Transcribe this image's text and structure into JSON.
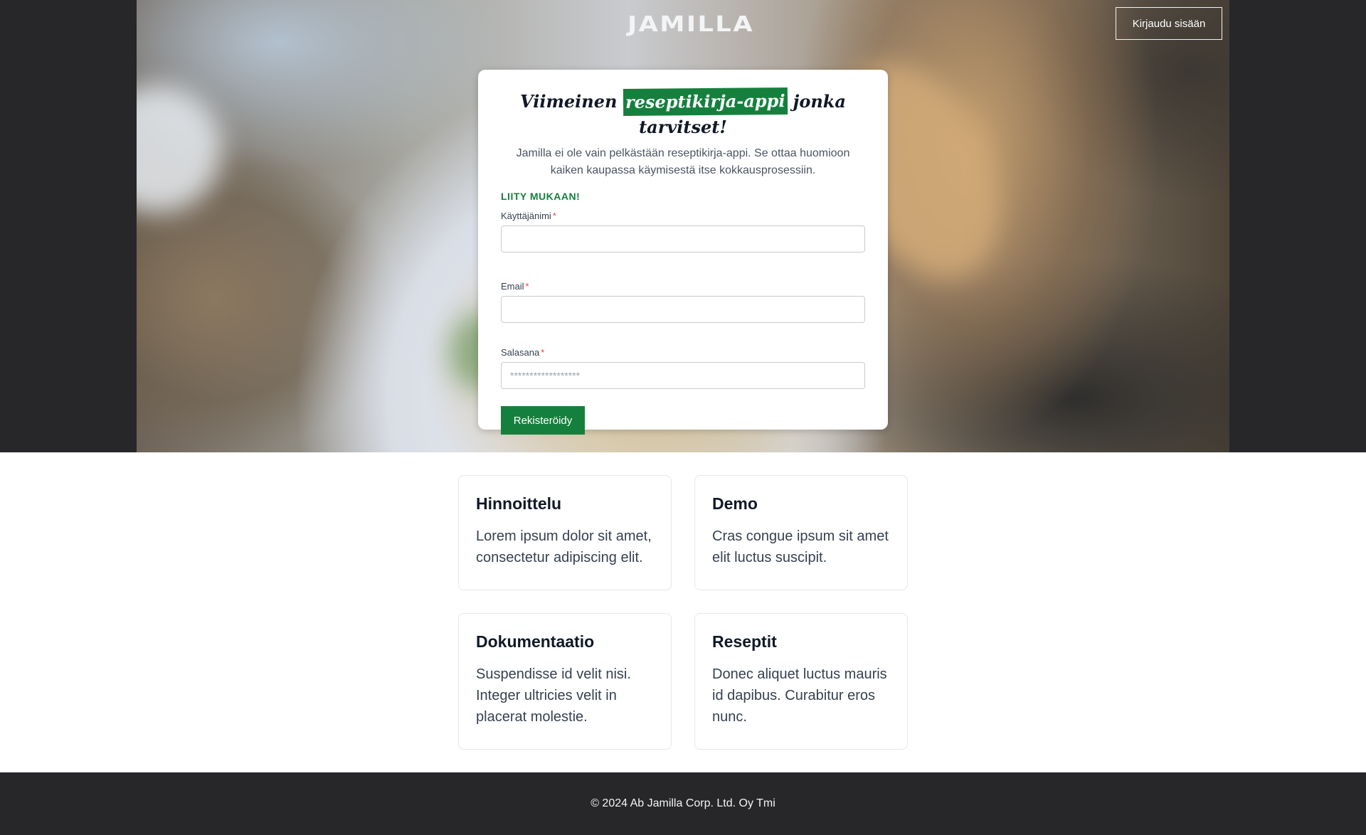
{
  "header": {
    "logo_text": "JAMILLA",
    "login_label": "Kirjaudu sisään"
  },
  "signup": {
    "headline_start": "Viimeinen",
    "headline_highlight": "reseptikirja-appi",
    "headline_end": "jonka tarvitset!",
    "subtitle": "Jamilla ei ole vain pelkästään reseptikirja-appi. Se ottaa huomioon kaiken kaupassa käymisestä itse kokkausprosessiin.",
    "join_label": "LIITY MUKAAN!",
    "username_label": "Käyttäjänimi",
    "email_label": "Email",
    "password_label": "Salasana",
    "required_mark": "*",
    "password_placeholder": "******************",
    "submit_label": "Rekisteröidy"
  },
  "features": [
    {
      "title": "Hinnoittelu",
      "text": "Lorem ipsum dolor sit amet, consectetur adipiscing elit."
    },
    {
      "title": "Demo",
      "text": "Cras congue ipsum sit amet elit luctus suscipit."
    },
    {
      "title": "Dokumentaatio",
      "text": "Suspendisse id velit nisi. Integer ultricies velit in placerat molestie."
    },
    {
      "title": "Reseptit",
      "text": "Donec aliquet luctus mauris id dapibus. Curabitur eros nunc."
    }
  ],
  "footer": {
    "copyright": "© 2024 Ab Jamilla Corp. Ltd. Oy Tmi"
  },
  "colors": {
    "accent": "#15803d",
    "dark": "#27272a",
    "required": "#ef4444"
  }
}
